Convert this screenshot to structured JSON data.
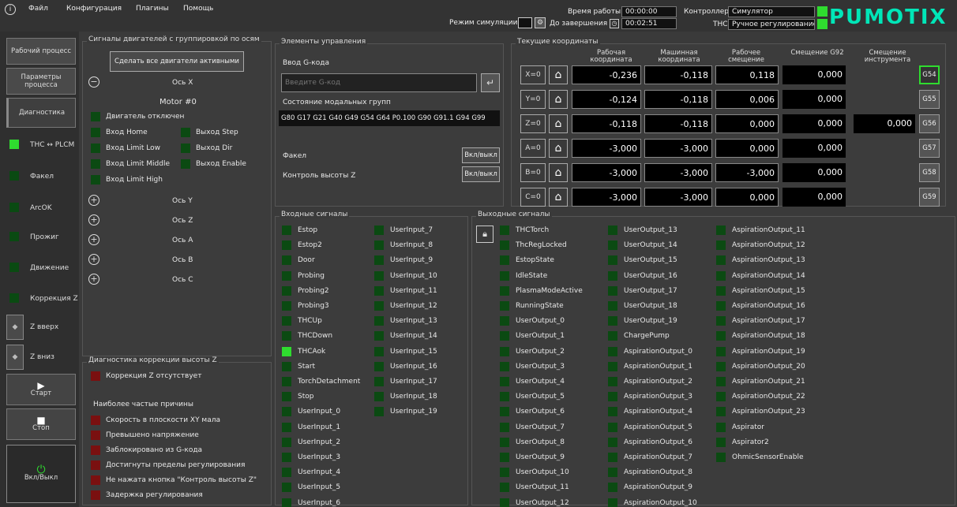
{
  "menu": {
    "info_icon": "info-icon",
    "file": "Файл",
    "config": "Конфигурация",
    "plugins": "Плагины",
    "help": "Помощь"
  },
  "top": {
    "sim_mode": "Режим симуляции",
    "work_time_label": "Время работы",
    "work_time": "00:00:00",
    "to_finish_label": "До завершения",
    "to_finish": "00:02:51",
    "controller_label": "Контроллер",
    "controller": "Симулятор",
    "thc_label": "THC",
    "thc_mode": "Ручное регулирование",
    "logo": "PUMOTIX"
  },
  "sidebar": {
    "workflow": "Рабочий процесс",
    "params": "Параметры процесса",
    "diagnostics": "Диагностика",
    "ind_thc": "THC ↔ PLCM",
    "ind_torch": "Факел",
    "ind_arcok": "ArcOK",
    "ind_pierce": "Прожиг",
    "ind_motion": "Движение",
    "ind_zcorr": "Коррекция Z",
    "zup": "Z вверх",
    "zdown": "Z вниз",
    "start": "Старт",
    "stop": "Стоп",
    "power": "Вкл/Выкл"
  },
  "motors": {
    "title": "Сигналы двигателей с группировкой по осям",
    "activate_btn": "Сделать все двигатели активными",
    "axis_x": "Ось X",
    "motor0": "Motor #0",
    "motor_off": "Двигатель отключен",
    "home_in": "Вход Home",
    "step_out": "Выход Step",
    "limit_low": "Вход Limit Low",
    "dir_out": "Выход Dir",
    "limit_mid": "Вход Limit Middle",
    "enable_out": "Выход Enable",
    "limit_high": "Вход Limit High",
    "axis_y": "Ось Y",
    "axis_z": "Ось Z",
    "axis_a": "Ось A",
    "axis_b": "Ось B",
    "axis_c": "Ось C"
  },
  "zdiag": {
    "title": "Диагностика коррекции высоты Z",
    "status": "Коррекция Z отсутствует",
    "causes_title": "Наиболее частые причины",
    "causes": [
      "Скорость в плоскости XY мала",
      "Превышено напряжение",
      "Заблокировано из G-кода",
      "Достигнуты пределы регулирования",
      "Не нажата кнопка \"Контроль высоты Z\"",
      "Задержка регулирования"
    ]
  },
  "controls": {
    "title": "Элементы управления",
    "gcode_label": "Ввод G-кода",
    "gcode_placeholder": "Введите G-код",
    "modal_label": "Состояние модальных групп",
    "modal_value": "G80 G17 G21 G40 G49 G54 G64 P0.100 G90 G91.1 G94 G99",
    "torch": "Факел",
    "torch_btn": "Вкл/выкл",
    "zctrl": "Контроль высоты Z",
    "zctrl_btn": "Вкл/выкл"
  },
  "coords": {
    "title": "Текущие координаты",
    "h_work": "Рабочая координата",
    "h_machine": "Машинная координата",
    "h_offset": "Рабочее смещение",
    "h_g92": "Смещение G92",
    "h_tool": "Смещение инструмента",
    "rows": [
      {
        "axis": "X=0",
        "work": "-0,236",
        "machine": "-0,118",
        "offset": "0,118",
        "g92": "0,000",
        "tool": "",
        "g": "G54"
      },
      {
        "axis": "Y=0",
        "work": "-0,124",
        "machine": "-0,118",
        "offset": "0,006",
        "g92": "0,000",
        "tool": "",
        "g": "G55"
      },
      {
        "axis": "Z=0",
        "work": "-0,118",
        "machine": "-0,118",
        "offset": "0,000",
        "g92": "0,000",
        "tool": "0,000",
        "g": "G56"
      },
      {
        "axis": "A=0",
        "work": "-3,000",
        "machine": "-3,000",
        "offset": "0,000",
        "g92": "0,000",
        "tool": "",
        "g": "G57"
      },
      {
        "axis": "B=0",
        "work": "-3,000",
        "machine": "-3,000",
        "offset": "-3,000",
        "g92": "0,000",
        "tool": "",
        "g": "G58"
      },
      {
        "axis": "C=0",
        "work": "-3,000",
        "machine": "-3,000",
        "offset": "0,000",
        "g92": "0,000",
        "tool": "",
        "g": "G59"
      }
    ]
  },
  "inputs": {
    "title": "Входные сигналы",
    "col1": [
      "Estop",
      "Estop2",
      "Door",
      "Probing",
      "Probing2",
      "Probing3",
      "THCUp",
      "THCDown",
      "THCAok",
      "Start",
      "TorchDetachment",
      "Stop",
      "UserInput_0",
      "UserInput_1",
      "UserInput_2",
      "UserInput_3",
      "UserInput_4",
      "UserInput_5",
      "UserInput_6"
    ],
    "col2": [
      "UserInput_7",
      "UserInput_8",
      "UserInput_9",
      "UserInput_10",
      "UserInput_11",
      "UserInput_12",
      "UserInput_13",
      "UserInput_14",
      "UserInput_15",
      "UserInput_16",
      "UserInput_17",
      "UserInput_18",
      "UserInput_19"
    ]
  },
  "outputs": {
    "title": "Выходные сигналы",
    "col1": [
      "THCTorch",
      "ThcRegLocked",
      "EstopState",
      "IdleState",
      "PlasmaModeActive",
      "RunningState",
      "UserOutput_0",
      "UserOutput_1",
      "UserOutput_2",
      "UserOutput_3",
      "UserOutput_4",
      "UserOutput_5",
      "UserOutput_6",
      "UserOutput_7",
      "UserOutput_8",
      "UserOutput_9",
      "UserOutput_10",
      "UserOutput_11",
      "UserOutput_12"
    ],
    "col2": [
      "UserOutput_13",
      "UserOutput_14",
      "UserOutput_15",
      "UserOutput_16",
      "UserOutput_17",
      "UserOutput_18",
      "UserOutput_19",
      "ChargePump",
      "AspirationOutput_0",
      "AspirationOutput_1",
      "AspirationOutput_2",
      "AspirationOutput_3",
      "AspirationOutput_4",
      "AspirationOutput_5",
      "AspirationOutput_6",
      "AspirationOutput_7",
      "AspirationOutput_8",
      "AspirationOutput_9",
      "AspirationOutput_10"
    ],
    "col3": [
      "AspirationOutput_11",
      "AspirationOutput_12",
      "AspirationOutput_13",
      "AspirationOutput_14",
      "AspirationOutput_15",
      "AspirationOutput_16",
      "AspirationOutput_17",
      "AspirationOutput_18",
      "AspirationOutput_19",
      "AspirationOutput_20",
      "AspirationOutput_21",
      "AspirationOutput_22",
      "AspirationOutput_23",
      "Aspirator",
      "Aspirator2",
      "OhmicSensorEnable"
    ]
  }
}
